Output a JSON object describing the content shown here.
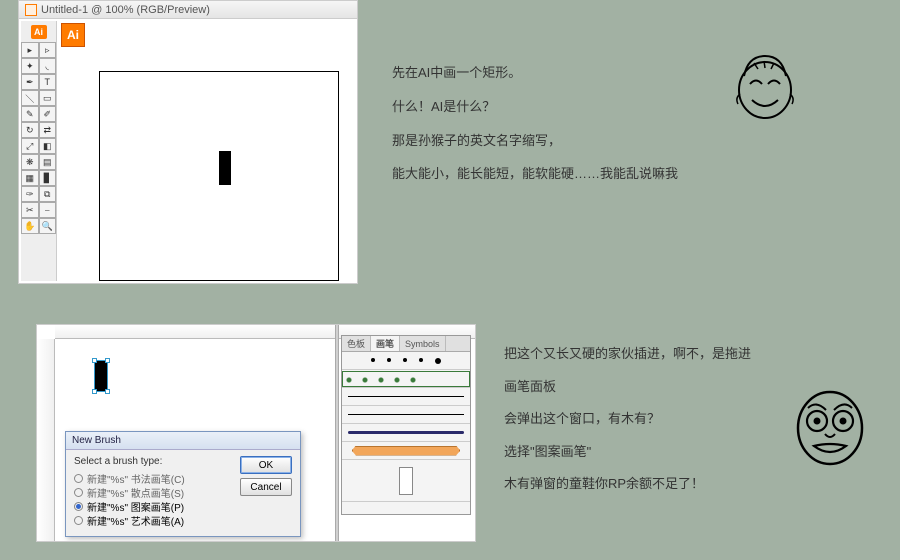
{
  "section1": {
    "window_title": "Untitled-1 @ 100% (RGB/Preview)",
    "ai_badge": "Ai",
    "ai_logo": "Ai",
    "text_lines": [
      "先在AI中画一个矩形。",
      "什么！AI是什么？",
      "那是孙猴子的英文名字缩写，",
      "能大能小，能长能短，能软能硬……我能乱说嘛我"
    ]
  },
  "section2": {
    "panel_tabs": [
      "色板",
      "画笔",
      "Symbols"
    ],
    "dialog": {
      "title": "New Brush",
      "label": "Select a brush type:",
      "options": [
        "新建\"%s\" 书法画笔(C)",
        "新建\"%s\" 散点画笔(S)",
        "新建\"%s\" 图案画笔(P)",
        "新建\"%s\" 艺术画笔(A)"
      ],
      "ok": "OK",
      "cancel": "Cancel"
    },
    "text_lines": [
      "把这个又长又硬的家伙插进，啊不，是拖进",
      "画笔面板",
      "会弹出这个窗口，有木有？",
      "选择\"图案画笔\"",
      "木有弹窗的童鞋你RP余额不足了！"
    ]
  }
}
